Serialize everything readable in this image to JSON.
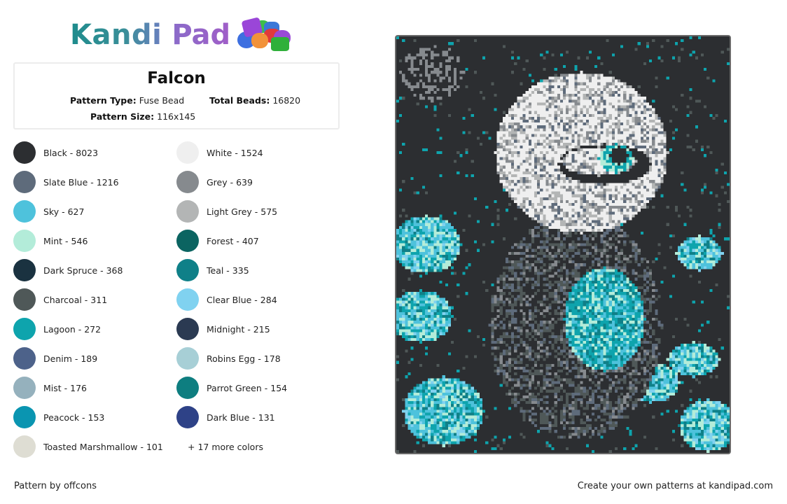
{
  "logo": {
    "text_primary": "Kandi",
    "text_secondary": "Pad",
    "icon": "bead-pile-icon"
  },
  "pattern_info": {
    "title": "Falcon",
    "type_label": "Pattern Type:",
    "type_value": "Fuse Bead",
    "total_label": "Total Beads:",
    "total_value": "16820",
    "size_label": "Pattern Size:",
    "size_value": "116x145"
  },
  "colors": [
    {
      "label": "Black - 8023",
      "hex": "#2c2e31"
    },
    {
      "label": "White - 1524",
      "hex": "#efefef"
    },
    {
      "label": "Slate Blue - 1216",
      "hex": "#5e6b7b"
    },
    {
      "label": "Grey - 639",
      "hex": "#868a8e"
    },
    {
      "label": "Sky - 627",
      "hex": "#4ec2dc"
    },
    {
      "label": "Light Grey - 575",
      "hex": "#b3b5b5"
    },
    {
      "label": "Mint - 546",
      "hex": "#b3ecd9"
    },
    {
      "label": "Forest - 407",
      "hex": "#0b6461"
    },
    {
      "label": "Dark Spruce - 368",
      "hex": "#1a3240"
    },
    {
      "label": "Teal - 335",
      "hex": "#0f8088"
    },
    {
      "label": "Charcoal - 311",
      "hex": "#4f5858"
    },
    {
      "label": "Clear Blue - 284",
      "hex": "#80d2f0"
    },
    {
      "label": "Lagoon - 272",
      "hex": "#0ea4ad"
    },
    {
      "label": "Midnight - 215",
      "hex": "#2b3a52"
    },
    {
      "label": "Denim - 189",
      "hex": "#4d628a"
    },
    {
      "label": "Robins Egg - 178",
      "hex": "#a7cfd6"
    },
    {
      "label": "Mist - 176",
      "hex": "#95b1bd"
    },
    {
      "label": "Parrot Green - 154",
      "hex": "#0e7e80"
    },
    {
      "label": "Peacock - 153",
      "hex": "#0a95b1"
    },
    {
      "label": "Dark Blue - 131",
      "hex": "#2e4287"
    },
    {
      "label": "Toasted Marshmallow - 101",
      "hex": "#deddd3"
    }
  ],
  "more_colors": "+ 17 more colors",
  "footer": {
    "author": "Pattern by offcons",
    "promo": "Create your own patterns at kandipad.com"
  },
  "pattern_image": {
    "description": "Falcon bead pattern with teal roses on dark background",
    "grid": "116x145"
  }
}
